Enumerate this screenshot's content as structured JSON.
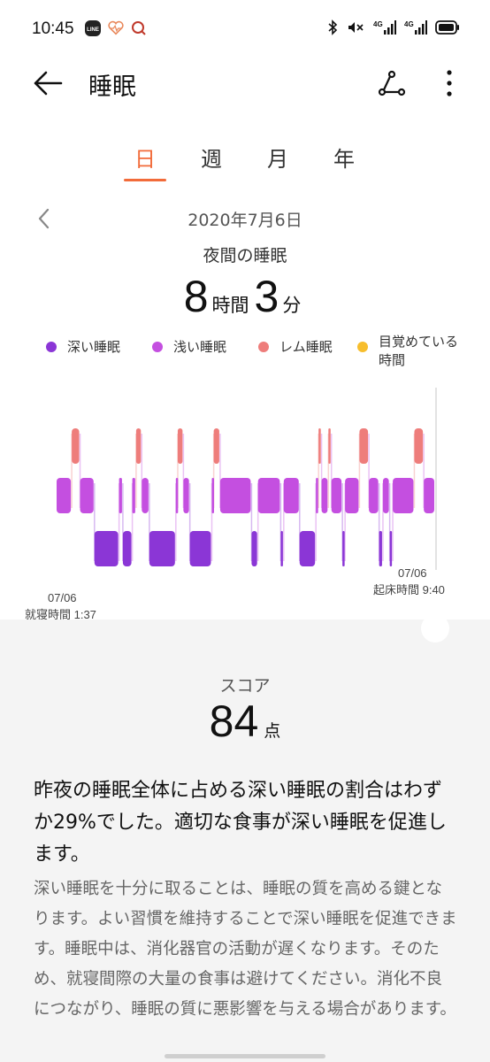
{
  "status_bar": {
    "time": "10:45",
    "app_icons": [
      "line-app-icon",
      "health-app-icon",
      "search-app-icon"
    ],
    "right_icons": [
      "bluetooth-icon",
      "mute-icon",
      "signal-4g-icon",
      "signal-4g-icon",
      "battery-icon"
    ],
    "network_label_1": "4G",
    "network_label_2": "4G",
    "line_label": "LINE"
  },
  "header": {
    "title": "睡眠"
  },
  "tabs": [
    {
      "label": "日",
      "active": true
    },
    {
      "label": "週",
      "active": false
    },
    {
      "label": "月",
      "active": false
    },
    {
      "label": "年",
      "active": false
    }
  ],
  "date_nav": {
    "date": "2020年7月6日",
    "caption": "夜間の睡眠"
  },
  "duration": {
    "hours": "8",
    "hours_unit": "時間",
    "minutes": "3",
    "minutes_unit": "分"
  },
  "legend": [
    {
      "label": "深い睡眠",
      "color": "#8b36d6"
    },
    {
      "label": "浅い睡眠",
      "color": "#c44fe0"
    },
    {
      "label": "レム睡眠",
      "color": "#ee7d7b"
    },
    {
      "label": "目覚めている時間",
      "color": "#f7be2d"
    }
  ],
  "chart_data": {
    "type": "sleep-stage-timeline",
    "stages": [
      "rem",
      "light",
      "deep"
    ],
    "colors": {
      "rem": "#ee7d7b",
      "light": "#c44fe0",
      "deep": "#8b36d6"
    },
    "segments": [
      {
        "stage": "light",
        "t0": 0.0,
        "t1": 0.04
      },
      {
        "stage": "rem",
        "t0": 0.04,
        "t1": 0.062
      },
      {
        "stage": "light",
        "t0": 0.062,
        "t1": 0.1
      },
      {
        "stage": "deep",
        "t0": 0.1,
        "t1": 0.165
      },
      {
        "stage": "light",
        "t0": 0.165,
        "t1": 0.175
      },
      {
        "stage": "deep",
        "t0": 0.175,
        "t1": 0.2
      },
      {
        "stage": "light",
        "t0": 0.2,
        "t1": 0.21
      },
      {
        "stage": "rem",
        "t0": 0.21,
        "t1": 0.225
      },
      {
        "stage": "light",
        "t0": 0.225,
        "t1": 0.245
      },
      {
        "stage": "deep",
        "t0": 0.245,
        "t1": 0.315
      },
      {
        "stage": "light",
        "t0": 0.315,
        "t1": 0.32
      },
      {
        "stage": "rem",
        "t0": 0.32,
        "t1": 0.335
      },
      {
        "stage": "light",
        "t0": 0.335,
        "t1": 0.352
      },
      {
        "stage": "deep",
        "t0": 0.352,
        "t1": 0.41
      },
      {
        "stage": "light",
        "t0": 0.41,
        "t1": 0.415
      },
      {
        "stage": "rem",
        "t0": 0.415,
        "t1": 0.432
      },
      {
        "stage": "light",
        "t0": 0.432,
        "t1": 0.515
      },
      {
        "stage": "deep",
        "t0": 0.515,
        "t1": 0.532
      },
      {
        "stage": "light",
        "t0": 0.532,
        "t1": 0.592
      },
      {
        "stage": "deep",
        "t0": 0.592,
        "t1": 0.6
      },
      {
        "stage": "light",
        "t0": 0.6,
        "t1": 0.642
      },
      {
        "stage": "deep",
        "t0": 0.642,
        "t1": 0.685
      },
      {
        "stage": "light",
        "t0": 0.685,
        "t1": 0.692
      },
      {
        "stage": "rem",
        "t0": 0.692,
        "t1": 0.7
      },
      {
        "stage": "light",
        "t0": 0.7,
        "t1": 0.718
      },
      {
        "stage": "rem",
        "t0": 0.718,
        "t1": 0.726
      },
      {
        "stage": "light",
        "t0": 0.726,
        "t1": 0.755
      },
      {
        "stage": "deep",
        "t0": 0.755,
        "t1": 0.762
      },
      {
        "stage": "light",
        "t0": 0.762,
        "t1": 0.8
      },
      {
        "stage": "rem",
        "t0": 0.8,
        "t1": 0.825
      },
      {
        "stage": "light",
        "t0": 0.825,
        "t1": 0.852
      },
      {
        "stage": "deep",
        "t0": 0.852,
        "t1": 0.862
      },
      {
        "stage": "light",
        "t0": 0.862,
        "t1": 0.88
      },
      {
        "stage": "deep",
        "t0": 0.88,
        "t1": 0.888
      },
      {
        "stage": "light",
        "t0": 0.888,
        "t1": 0.945
      },
      {
        "stage": "rem",
        "t0": 0.945,
        "t1": 0.97
      },
      {
        "stage": "light",
        "t0": 0.97,
        "t1": 1.0
      }
    ],
    "start_date": "07/06",
    "start_label": "就寝時間 1:37",
    "end_date": "07/06",
    "end_label": "起床時間 9:40"
  },
  "score": {
    "label": "スコア",
    "value": "84",
    "unit": "点"
  },
  "summary": "昨夜の睡眠全体に占める深い睡眠の割合はわずか29%でした。適切な食事が深い睡眠を促進します。",
  "detail": "深い睡眠を十分に取ることは、睡眠の質を高める鍵となります。よい習慣を維持することで深い睡眠を促進できます。睡眠中は、消化器官の活動が遅くなります。そのため、就寝間際の大量の食事は避けてください。消化不良につながり、睡眠の質に悪影響を与える場合があります。"
}
